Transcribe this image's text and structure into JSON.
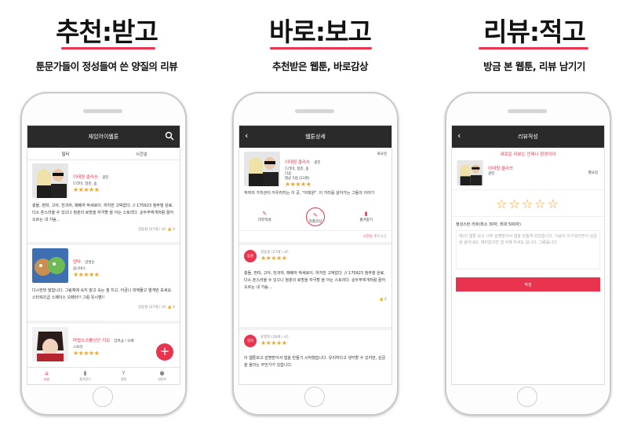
{
  "panels": [
    {
      "headline": "추천:받고",
      "sub": "툰문가들이 정성들여 쓴 양질의 리뷰"
    },
    {
      "headline": "바로:보고",
      "sub": "추천받은 웹툰, 바로감상"
    },
    {
      "headline": "리뷰:적고",
      "sub": "방금 본 웹툰, 리뷰 남기기"
    }
  ],
  "screen1": {
    "title": "재있어이웹툰",
    "tabs": [
      "필터",
      "시간순"
    ],
    "cards": [
      {
        "title": "이태원 클라쓰",
        "author": "광진",
        "genre": "드라마, 청춘, 솜",
        "stars": "★★★★★",
        "text": "충돌, 펀따, 고아, 전과자, 패배자 박새로이. 하지만 고박없다. // 170923 첨주행 완료. 다소 촌스러울 수 있으나 청춘의 로망을 자극할 을 아는 스토리다. 순두부찌개처럼 끌어 오르는 내 가슴...",
        "meta": "김동원 (27세 / ♂)",
        "likes": "0"
      },
      {
        "title": "덴마",
        "author": "양영순",
        "genre": "음니버스",
        "stars": "★★★★★",
        "text": "다시한번 말합니다. 그림체에 속지 말고 속는 셈 치고, 어금니 꽉깨물고 열개만 보세요. 스타워즈급 스페이스 오페라!! 그럼 뭇시멤!!",
        "meta": "김동원 (27세 / ♂)",
        "likes": "0"
      },
      {
        "title": "마법스크롤상인 지오",
        "author": "임파금 / 오배",
        "genre": "스토리",
        "stars": "★★★★★"
      }
    ],
    "nav": [
      "리뷰",
      "즐겨찾기",
      "랭킹",
      "내정보"
    ],
    "fab": "+"
  },
  "screen2": {
    "title": "웹툰상세",
    "webtoon": {
      "title": "이태원 클라쓰",
      "author": "광진",
      "day": "화요일",
      "genre": "드라마, 청춘, 솜",
      "extra": "다음",
      "rating": "평균 5점 (23명)",
      "stars": "★★★★★"
    },
    "quote": "작자의 가치관이 어우러지는 이 곳, \"이태원\". 이 거리를 살아가는 그들의 이야기",
    "actions": [
      "리뷰작성",
      "작품감상",
      "즐겨찾기"
    ],
    "sort": [
      "시간순",
      "좋아요순"
    ],
    "reviews": [
      {
        "avatar": "동원",
        "name": "김동원 (27세 / ♂)",
        "stars": "★★★★★",
        "text": "충돌, 펀따, 고아, 전과자, 패배자 박새로이. 하지만 고박없다. // 170923 첨주행 완료. 다소 촌스러울 수 있으나 청춘의 로망을 자극할 을 아는 스토리다. 순두부찌개처럼 끌어 오르는 내 가슴...",
        "likes": "0"
      },
      {
        "avatar": "영지",
        "name": "윤영지 (26세 / ♂)",
        "stars": "★★★★★",
        "text": "이 웹툰보고 감명받아서 앱을 만들기 시작했습니다. 유리하다고 생각할 수 있지만, 심금을 울리는 무언가가 있습니다."
      }
    ]
  },
  "screen3": {
    "title": "리뷰작성",
    "banner": "새로운 리뷰는 언제나 환영이야",
    "webtoon": {
      "title": "이태원 클라쓰",
      "author": "광진",
      "day": "월요일"
    },
    "stars": "☆☆☆☆☆",
    "label": "정성스런 리뷰(최소 30자, 최대 500자)",
    "placeholder": "예)이 웹툰 보고 너무 감명받아서 앱을 만들게 되었습니다. 가슴이 뜨거워지면서 심금을 울리네요. 재미없으면 앱 삭제 하셔도 됩니다. 그럼음니다.",
    "submit": "작성"
  },
  "colors": {
    "accent": "#e8344e",
    "star": "#f4a227",
    "topbar": "#2a2a2a"
  }
}
